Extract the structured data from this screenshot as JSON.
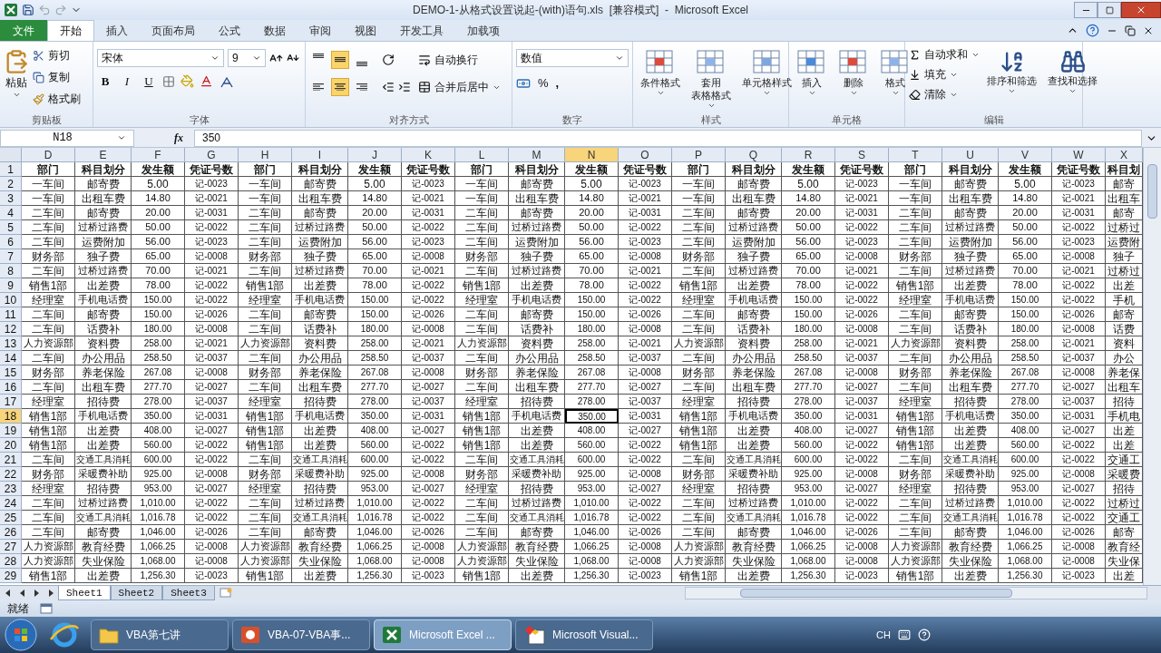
{
  "window": {
    "title": "DEMO-1-从格式设置说起-(with)语句.xls  [兼容模式]  -  Microsoft Excel"
  },
  "file_tab": "文件",
  "tabs": [
    {
      "label": "开始",
      "selected": true
    },
    {
      "label": "插入",
      "selected": false
    },
    {
      "label": "页面布局",
      "selected": false
    },
    {
      "label": "公式",
      "selected": false
    },
    {
      "label": "数据",
      "selected": false
    },
    {
      "label": "审阅",
      "selected": false
    },
    {
      "label": "视图",
      "selected": false
    },
    {
      "label": "开发工具",
      "selected": false
    },
    {
      "label": "加载项",
      "selected": false
    }
  ],
  "ribbon": {
    "clipboard": {
      "title": "剪贴板",
      "paste": "粘贴",
      "cut": "剪切",
      "copy": "复制",
      "format_painter": "格式刷"
    },
    "font": {
      "title": "字体",
      "font_name": "宋体",
      "font_size": "9",
      "bold": "B",
      "italic": "I",
      "underline": "U"
    },
    "alignment": {
      "title": "对齐方式",
      "vertical": [
        {
          "selected": false
        },
        {
          "selected": true
        },
        {
          "selected": false
        }
      ],
      "horizontal": [
        {
          "selected": false
        },
        {
          "selected": true
        },
        {
          "selected": false
        }
      ],
      "wrap": "自动换行",
      "merge": "合并后居中"
    },
    "number": {
      "title": "数字",
      "format": "数值",
      "percent": "%",
      "comma": ","
    },
    "styles": {
      "title": "样式",
      "buttons": [
        [
          "条件格式"
        ],
        [
          "套用",
          "表格格式"
        ],
        [
          "单元格样式"
        ]
      ]
    },
    "cells": {
      "title": "单元格",
      "buttons": [
        "插入",
        "删除",
        "格式"
      ]
    },
    "editing": {
      "title": "编辑",
      "items": [
        "自动求和",
        "填充",
        "清除"
      ],
      "buttons": [
        "排序和筛选",
        "查找和选择"
      ]
    }
  },
  "formula_bar": {
    "name_box": "N18",
    "fx": "fx",
    "value": "350"
  },
  "columns": [
    {
      "label": "D",
      "selected": false
    },
    {
      "label": "E",
      "selected": false
    },
    {
      "label": "F",
      "selected": false
    },
    {
      "label": "G",
      "selected": false
    },
    {
      "label": "H",
      "selected": false
    },
    {
      "label": "I",
      "selected": false
    },
    {
      "label": "J",
      "selected": false
    },
    {
      "label": "K",
      "selected": false
    },
    {
      "label": "L",
      "selected": false
    },
    {
      "label": "M",
      "selected": false
    },
    {
      "label": "N",
      "selected": true
    },
    {
      "label": "O",
      "selected": false
    },
    {
      "label": "P",
      "selected": false
    },
    {
      "label": "Q",
      "selected": false
    },
    {
      "label": "R",
      "selected": false
    },
    {
      "label": "S",
      "selected": false
    },
    {
      "label": "T",
      "selected": false
    },
    {
      "label": "U",
      "selected": false
    },
    {
      "label": "V",
      "selected": false
    },
    {
      "label": "W",
      "selected": false
    },
    {
      "label": "X",
      "selected": false
    }
  ],
  "rows": [
    {
      "number": "1",
      "kind": "header",
      "selected": false,
      "cells": [
        "部门",
        "科目划分",
        "发生额",
        "凭证号数",
        "部门",
        "科目划分",
        "发生额",
        "凭证号数",
        "部门",
        "科目划分",
        "发生额",
        "凭证号数",
        "部门",
        "科目划分",
        "发生额",
        "凭证号数",
        "部门",
        "科目划分",
        "发生额",
        "凭证号数",
        "科目划"
      ]
    },
    {
      "number": "2",
      "kind": "data",
      "selected": false,
      "cells": [
        "一车间",
        "邮寄费",
        "5.00",
        "记-0023",
        "一车间",
        "邮寄费",
        "5.00",
        "记-0023",
        "一车间",
        "邮寄费",
        "5.00",
        "记-0023",
        "一车间",
        "邮寄费",
        "5.00",
        "记-0023",
        "一车间",
        "邮寄费",
        "5.00",
        "记-0023",
        "邮寄"
      ]
    },
    {
      "number": "3",
      "kind": "data",
      "selected": false,
      "cells": [
        "一车间",
        "出租车费",
        "14.80",
        "记-0021",
        "一车间",
        "出租车费",
        "14.80",
        "记-0021",
        "一车间",
        "出租车费",
        "14.80",
        "记-0021",
        "一车间",
        "出租车费",
        "14.80",
        "记-0021",
        "一车间",
        "出租车费",
        "14.80",
        "记-0021",
        "出租车"
      ]
    },
    {
      "number": "4",
      "kind": "data",
      "selected": false,
      "cells": [
        "二车间",
        "邮寄费",
        "20.00",
        "记-0031",
        "二车间",
        "邮寄费",
        "20.00",
        "记-0031",
        "二车间",
        "邮寄费",
        "20.00",
        "记-0031",
        "二车间",
        "邮寄费",
        "20.00",
        "记-0031",
        "二车间",
        "邮寄费",
        "20.00",
        "记-0031",
        "邮寄"
      ]
    },
    {
      "number": "5",
      "kind": "data",
      "selected": false,
      "cells": [
        "二车间",
        "过桥过路费",
        "50.00",
        "记-0022",
        "二车间",
        "过桥过路费",
        "50.00",
        "记-0022",
        "二车间",
        "过桥过路费",
        "50.00",
        "记-0022",
        "二车间",
        "过桥过路费",
        "50.00",
        "记-0022",
        "二车间",
        "过桥过路费",
        "50.00",
        "记-0022",
        "过桥过"
      ]
    },
    {
      "number": "6",
      "kind": "data",
      "selected": false,
      "cells": [
        "二车间",
        "运费附加",
        "56.00",
        "记-0023",
        "二车间",
        "运费附加",
        "56.00",
        "记-0023",
        "二车间",
        "运费附加",
        "56.00",
        "记-0023",
        "二车间",
        "运费附加",
        "56.00",
        "记-0023",
        "二车间",
        "运费附加",
        "56.00",
        "记-0023",
        "运费附"
      ]
    },
    {
      "number": "7",
      "kind": "data",
      "selected": false,
      "cells": [
        "财务部",
        "独子费",
        "65.00",
        "记-0008",
        "财务部",
        "独子费",
        "65.00",
        "记-0008",
        "财务部",
        "独子费",
        "65.00",
        "记-0008",
        "财务部",
        "独子费",
        "65.00",
        "记-0008",
        "财务部",
        "独子费",
        "65.00",
        "记-0008",
        "独子"
      ]
    },
    {
      "number": "8",
      "kind": "data",
      "selected": false,
      "cells": [
        "二车间",
        "过桥过路费",
        "70.00",
        "记-0021",
        "二车间",
        "过桥过路费",
        "70.00",
        "记-0021",
        "二车间",
        "过桥过路费",
        "70.00",
        "记-0021",
        "二车间",
        "过桥过路费",
        "70.00",
        "记-0021",
        "二车间",
        "过桥过路费",
        "70.00",
        "记-0021",
        "过桥过"
      ]
    },
    {
      "number": "9",
      "kind": "data",
      "selected": false,
      "cells": [
        "销售1部",
        "出差费",
        "78.00",
        "记-0022",
        "销售1部",
        "出差费",
        "78.00",
        "记-0022",
        "销售1部",
        "出差费",
        "78.00",
        "记-0022",
        "销售1部",
        "出差费",
        "78.00",
        "记-0022",
        "销售1部",
        "出差费",
        "78.00",
        "记-0022",
        "出差"
      ]
    },
    {
      "number": "10",
      "kind": "data",
      "selected": false,
      "cells": [
        "经理室",
        "手机电话费",
        "150.00",
        "记-0022",
        "经理室",
        "手机电话费",
        "150.00",
        "记-0022",
        "经理室",
        "手机电话费",
        "150.00",
        "记-0022",
        "经理室",
        "手机电话费",
        "150.00",
        "记-0022",
        "经理室",
        "手机电话费",
        "150.00",
        "记-0022",
        "手机"
      ]
    },
    {
      "number": "11",
      "kind": "data",
      "selected": false,
      "cells": [
        "二车间",
        "邮寄费",
        "150.00",
        "记-0026",
        "二车间",
        "邮寄费",
        "150.00",
        "记-0026",
        "二车间",
        "邮寄费",
        "150.00",
        "记-0026",
        "二车间",
        "邮寄费",
        "150.00",
        "记-0026",
        "二车间",
        "邮寄费",
        "150.00",
        "记-0026",
        "邮寄"
      ]
    },
    {
      "number": "12",
      "kind": "data",
      "selected": false,
      "cells": [
        "二车间",
        "话费补",
        "180.00",
        "记-0008",
        "二车间",
        "话费补",
        "180.00",
        "记-0008",
        "二车间",
        "话费补",
        "180.00",
        "记-0008",
        "二车间",
        "话费补",
        "180.00",
        "记-0008",
        "二车间",
        "话费补",
        "180.00",
        "记-0008",
        "话费"
      ]
    },
    {
      "number": "13",
      "kind": "data",
      "selected": false,
      "cells": [
        "人力资源部",
        "资料费",
        "258.00",
        "记-0021",
        "人力资源部",
        "资料费",
        "258.00",
        "记-0021",
        "人力资源部",
        "资料费",
        "258.00",
        "记-0021",
        "人力资源部",
        "资料费",
        "258.00",
        "记-0021",
        "人力资源部",
        "资料费",
        "258.00",
        "记-0021",
        "资料"
      ]
    },
    {
      "number": "14",
      "kind": "data",
      "selected": false,
      "cells": [
        "二车间",
        "办公用品",
        "258.50",
        "记-0037",
        "二车间",
        "办公用品",
        "258.50",
        "记-0037",
        "二车间",
        "办公用品",
        "258.50",
        "记-0037",
        "二车间",
        "办公用品",
        "258.50",
        "记-0037",
        "二车间",
        "办公用品",
        "258.50",
        "记-0037",
        "办公"
      ]
    },
    {
      "number": "15",
      "kind": "data",
      "selected": false,
      "cells": [
        "财务部",
        "养老保险",
        "267.08",
        "记-0008",
        "财务部",
        "养老保险",
        "267.08",
        "记-0008",
        "财务部",
        "养老保险",
        "267.08",
        "记-0008",
        "财务部",
        "养老保险",
        "267.08",
        "记-0008",
        "财务部",
        "养老保险",
        "267.08",
        "记-0008",
        "养老保"
      ]
    },
    {
      "number": "16",
      "kind": "data",
      "selected": false,
      "cells": [
        "二车间",
        "出租车费",
        "277.70",
        "记-0027",
        "二车间",
        "出租车费",
        "277.70",
        "记-0027",
        "二车间",
        "出租车费",
        "277.70",
        "记-0027",
        "二车间",
        "出租车费",
        "277.70",
        "记-0027",
        "二车间",
        "出租车费",
        "277.70",
        "记-0027",
        "出租车"
      ]
    },
    {
      "number": "17",
      "kind": "data",
      "selected": false,
      "cells": [
        "经理室",
        "招待费",
        "278.00",
        "记-0037",
        "经理室",
        "招待费",
        "278.00",
        "记-0037",
        "经理室",
        "招待费",
        "278.00",
        "记-0037",
        "经理室",
        "招待费",
        "278.00",
        "记-0037",
        "经理室",
        "招待费",
        "278.00",
        "记-0037",
        "招待"
      ]
    },
    {
      "number": "18",
      "kind": "data",
      "selected": true,
      "cells": [
        "销售1部",
        "手机电话费",
        "350.00",
        "记-0031",
        "销售1部",
        "手机电话费",
        "350.00",
        "记-0031",
        "销售1部",
        "手机电话费",
        "350.00",
        "记-0031",
        "销售1部",
        "手机电话费",
        "350.00",
        "记-0031",
        "销售1部",
        "手机电话费",
        "350.00",
        "记-0031",
        "手机电"
      ]
    },
    {
      "number": "19",
      "kind": "data",
      "selected": false,
      "cells": [
        "销售1部",
        "出差费",
        "408.00",
        "记-0027",
        "销售1部",
        "出差费",
        "408.00",
        "记-0027",
        "销售1部",
        "出差费",
        "408.00",
        "记-0027",
        "销售1部",
        "出差费",
        "408.00",
        "记-0027",
        "销售1部",
        "出差费",
        "408.00",
        "记-0027",
        "出差"
      ]
    },
    {
      "number": "20",
      "kind": "data",
      "selected": false,
      "cells": [
        "销售1部",
        "出差费",
        "560.00",
        "记-0022",
        "销售1部",
        "出差费",
        "560.00",
        "记-0022",
        "销售1部",
        "出差费",
        "560.00",
        "记-0022",
        "销售1部",
        "出差费",
        "560.00",
        "记-0022",
        "销售1部",
        "出差费",
        "560.00",
        "记-0022",
        "出差"
      ]
    },
    {
      "number": "21",
      "kind": "data",
      "selected": false,
      "cells": [
        "二车间",
        "交通工具消耗",
        "600.00",
        "记-0022",
        "二车间",
        "交通工具消耗",
        "600.00",
        "记-0022",
        "二车间",
        "交通工具消耗",
        "600.00",
        "记-0022",
        "二车间",
        "交通工具消耗",
        "600.00",
        "记-0022",
        "二车间",
        "交通工具消耗",
        "600.00",
        "记-0022",
        "交通工"
      ]
    },
    {
      "number": "22",
      "kind": "data",
      "selected": false,
      "cells": [
        "财务部",
        "采暖费补助",
        "925.00",
        "记-0008",
        "财务部",
        "采暖费补助",
        "925.00",
        "记-0008",
        "财务部",
        "采暖费补助",
        "925.00",
        "记-0008",
        "财务部",
        "采暖费补助",
        "925.00",
        "记-0008",
        "财务部",
        "采暖费补助",
        "925.00",
        "记-0008",
        "采暖费"
      ]
    },
    {
      "number": "23",
      "kind": "data",
      "selected": false,
      "cells": [
        "经理室",
        "招待费",
        "953.00",
        "记-0027",
        "经理室",
        "招待费",
        "953.00",
        "记-0027",
        "经理室",
        "招待费",
        "953.00",
        "记-0027",
        "经理室",
        "招待费",
        "953.00",
        "记-0027",
        "经理室",
        "招待费",
        "953.00",
        "记-0027",
        "招待"
      ]
    },
    {
      "number": "24",
      "kind": "data",
      "selected": false,
      "cells": [
        "二车间",
        "过桥过路费",
        "1,010.00",
        "记-0022",
        "二车间",
        "过桥过路费",
        "1,010.00",
        "记-0022",
        "二车间",
        "过桥过路费",
        "1,010.00",
        "记-0022",
        "二车间",
        "过桥过路费",
        "1,010.00",
        "记-0022",
        "二车间",
        "过桥过路费",
        "1,010.00",
        "记-0022",
        "过桥过"
      ]
    },
    {
      "number": "25",
      "kind": "data",
      "selected": false,
      "cells": [
        "二车间",
        "交通工具消耗",
        "1,016.78",
        "记-0022",
        "二车间",
        "交通工具消耗",
        "1,016.78",
        "记-0022",
        "二车间",
        "交通工具消耗",
        "1,016.78",
        "记-0022",
        "二车间",
        "交通工具消耗",
        "1,016.78",
        "记-0022",
        "二车间",
        "交通工具消耗",
        "1,016.78",
        "记-0022",
        "交通工"
      ]
    },
    {
      "number": "26",
      "kind": "data",
      "selected": false,
      "cells": [
        "二车间",
        "邮寄费",
        "1,046.00",
        "记-0026",
        "二车间",
        "邮寄费",
        "1,046.00",
        "记-0026",
        "二车间",
        "邮寄费",
        "1,046.00",
        "记-0026",
        "二车间",
        "邮寄费",
        "1,046.00",
        "记-0026",
        "二车间",
        "邮寄费",
        "1,046.00",
        "记-0026",
        "邮寄"
      ]
    },
    {
      "number": "27",
      "kind": "data",
      "selected": false,
      "cells": [
        "人力资源部",
        "教育经费",
        "1,066.25",
        "记-0008",
        "人力资源部",
        "教育经费",
        "1,066.25",
        "记-0008",
        "人力资源部",
        "教育经费",
        "1,066.25",
        "记-0008",
        "人力资源部",
        "教育经费",
        "1,066.25",
        "记-0008",
        "人力资源部",
        "教育经费",
        "1,066.25",
        "记-0008",
        "教育经"
      ]
    },
    {
      "number": "28",
      "kind": "data",
      "selected": false,
      "cells": [
        "人力资源部",
        "失业保险",
        "1,068.00",
        "记-0008",
        "人力资源部",
        "失业保险",
        "1,068.00",
        "记-0008",
        "人力资源部",
        "失业保险",
        "1,068.00",
        "记-0008",
        "人力资源部",
        "失业保险",
        "1,068.00",
        "记-0008",
        "人力资源部",
        "失业保险",
        "1,068.00",
        "记-0008",
        "失业保"
      ]
    },
    {
      "number": "29",
      "kind": "data",
      "selected": false,
      "cells": [
        "销售1部",
        "出差费",
        "1,256.30",
        "记-0023",
        "销售1部",
        "出差费",
        "1,256.30",
        "记-0023",
        "销售1部",
        "出差费",
        "1,256.30",
        "记-0023",
        "销售1部",
        "出差费",
        "1,256.30",
        "记-0023",
        "销售1部",
        "出差费",
        "1,256.30",
        "记-0023",
        "出差"
      ]
    }
  ],
  "sheets": [
    {
      "label": "Sheet1",
      "selected": true
    },
    {
      "label": "Sheet2",
      "selected": false
    },
    {
      "label": "Sheet3",
      "selected": false
    }
  ],
  "status_bar": {
    "text": "就绪"
  },
  "taskbar": {
    "items": [
      {
        "kind": "folder",
        "label": "VBA第七讲",
        "selected": false
      },
      {
        "kind": "slides",
        "label": "VBA-07-VBA事...",
        "selected": false
      },
      {
        "kind": "sheet",
        "label": "Microsoft Excel ...",
        "selected": true
      },
      {
        "kind": "vb",
        "label": "Microsoft Visual...",
        "selected": false
      }
    ],
    "language": "CH"
  }
}
